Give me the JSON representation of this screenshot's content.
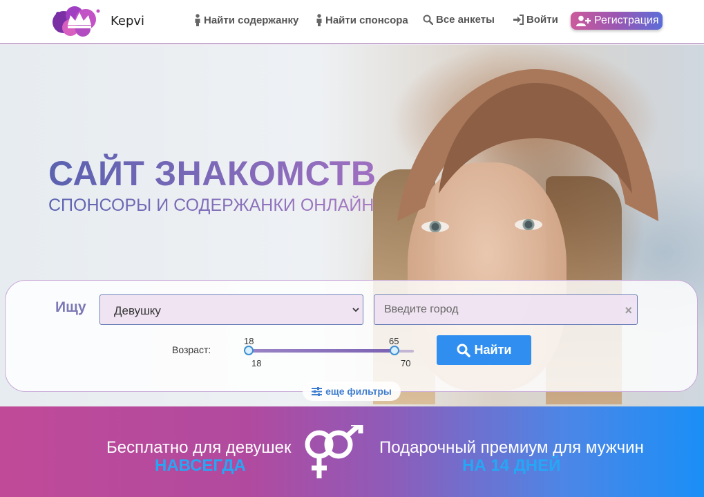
{
  "header": {
    "brand": "Kepvi",
    "nav": {
      "find_kept": "Найти содержанку",
      "find_sponsor": "Найти спонсора",
      "all_profiles": "Все анкеты",
      "login": "Войти",
      "register": "Регистрация"
    }
  },
  "hero": {
    "title": "САЙТ ЗНАКОМСТВ",
    "subtitle": "СПОНСОРЫ И СОДЕРЖАНКИ ОНЛАЙН"
  },
  "search": {
    "seek_label": "Ищу",
    "seek_value": "Девушку",
    "city_placeholder": "Введите город",
    "clear_symbol": "×",
    "age_label": "Возраст:",
    "age_from": "18",
    "age_to": "65",
    "age_min": "18",
    "age_max": "70",
    "age_fraction_from": 0.0,
    "age_fraction_to": 0.8846,
    "find_button": "Найти",
    "more_filters": "еще фильтры"
  },
  "promo": {
    "left_line1": "Бесплатно для девушек",
    "left_line2": "НАВСЕГДА",
    "right_line1": "Подарочный премиум для мужчин",
    "right_line2": "НА 14 ДНЕЙ"
  },
  "icons": {
    "nav_person": "person-icon",
    "search": "search-icon",
    "login": "sign-in-icon",
    "register": "user-plus-icon",
    "filters": "sliders-icon",
    "gender": "gender-icon",
    "dropdown": "chevron-down-icon"
  },
  "colors": {
    "brand_purple": "#7d78b6",
    "find_button": "#2f8ef0",
    "promo_highlight": "#25a7f5"
  }
}
